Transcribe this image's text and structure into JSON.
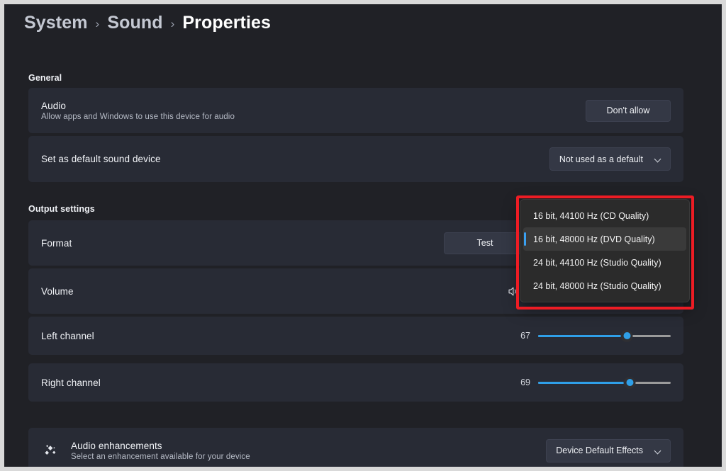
{
  "breadcrumb": {
    "items": [
      {
        "label": "System",
        "current": false
      },
      {
        "label": "Sound",
        "current": false
      },
      {
        "label": "Properties",
        "current": true
      }
    ],
    "separator": "›"
  },
  "sections": {
    "general": {
      "label": "General",
      "audio": {
        "title": "Audio",
        "subtitle": "Allow apps and Windows to use this device for audio",
        "button_label": "Don't allow"
      },
      "default_device": {
        "title": "Set as default sound device",
        "select_value": "Not used as a default"
      }
    },
    "output": {
      "label": "Output settings",
      "format": {
        "title": "Format",
        "test_button_label": "Test",
        "options": [
          "16 bit, 44100 Hz (CD Quality)",
          "16 bit, 48000 Hz (DVD Quality)",
          "24 bit, 44100 Hz (Studio Quality)",
          "24 bit, 48000 Hz (Studio Quality)"
        ],
        "selected_index": 1,
        "dropdown_open": true
      },
      "volume": {
        "title": "Volume",
        "icon": "speaker-icon"
      },
      "left_channel": {
        "title": "Left channel",
        "value": 67,
        "min": 0,
        "max": 100
      },
      "right_channel": {
        "title": "Right channel",
        "value": 69,
        "min": 0,
        "max": 100
      }
    },
    "enhancements": {
      "title": "Audio enhancements",
      "subtitle": "Select an enhancement available for your device",
      "icon": "sparkle-icon",
      "select_value": "Device Default Effects"
    }
  },
  "colors": {
    "page_background": "#202126",
    "card_background": "#282b35",
    "accent_blue": "#2f9fe8",
    "annotation_red": "#ed1c24",
    "popup_background": "#2b2b2b",
    "text_primary": "#f2f4f8",
    "text_secondary": "#b6bbc6"
  }
}
